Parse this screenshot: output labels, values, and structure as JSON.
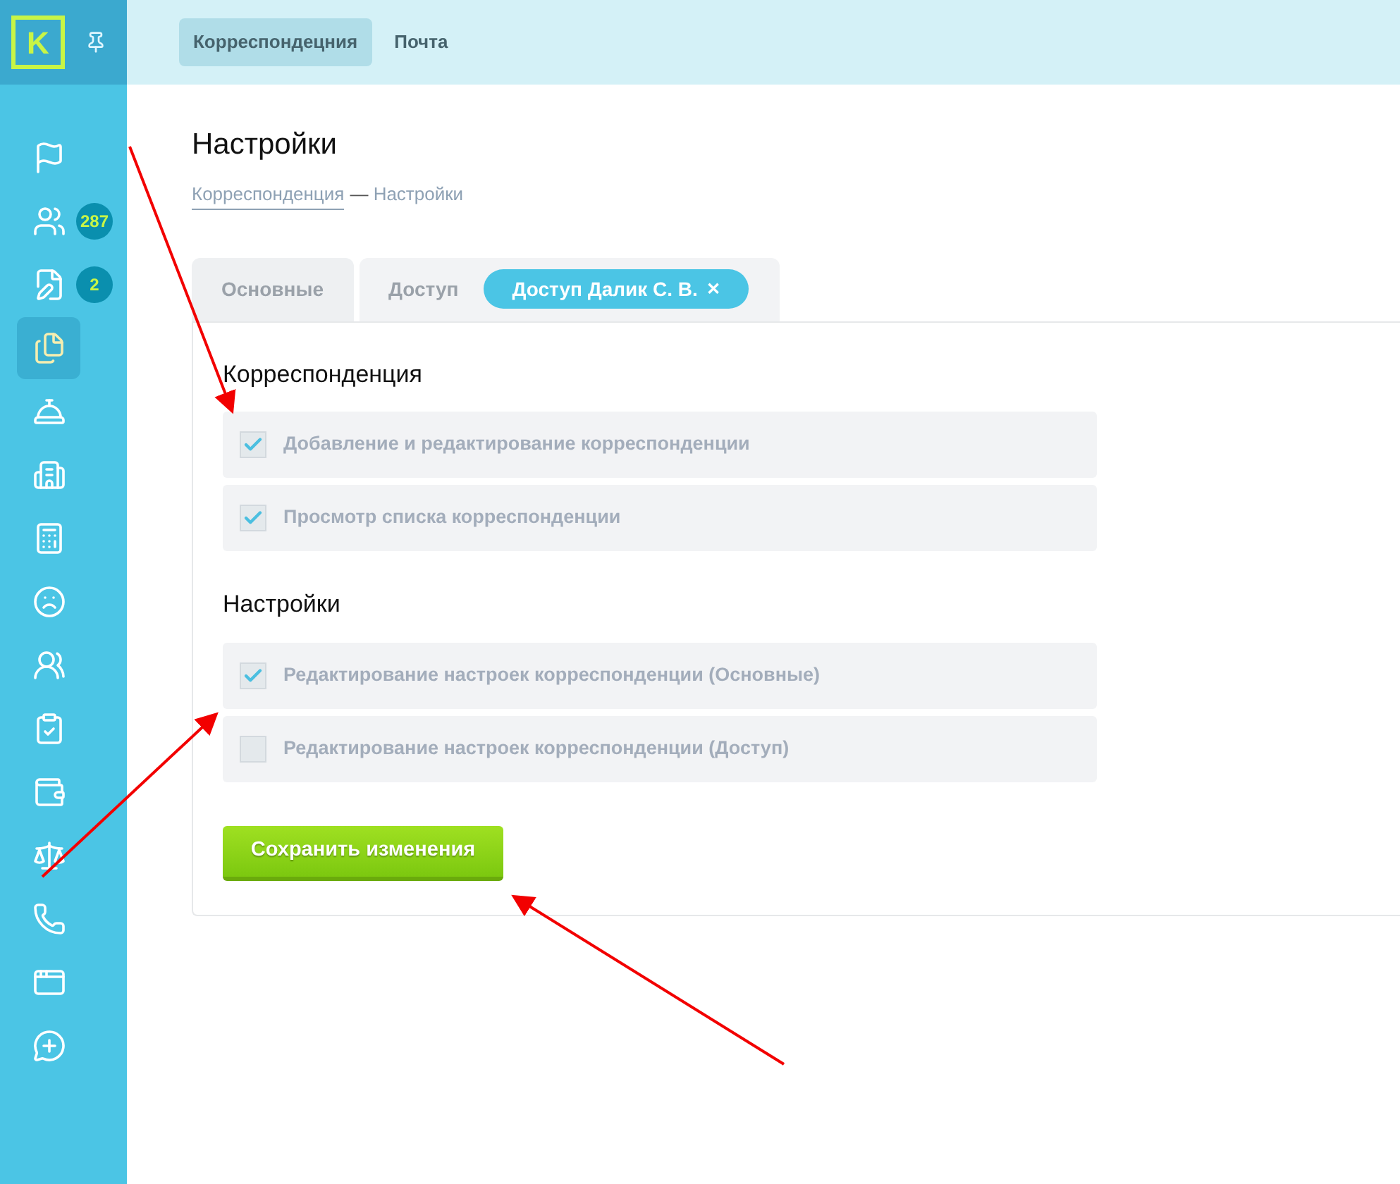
{
  "sidebar": {
    "logo": "K",
    "items": [
      {
        "selected": false
      },
      {
        "selected": false,
        "badge": "287"
      },
      {
        "selected": false,
        "badge": "2"
      },
      {
        "selected": true
      },
      {
        "selected": false
      },
      {
        "selected": false
      },
      {
        "selected": false
      },
      {
        "selected": false
      },
      {
        "selected": false
      },
      {
        "selected": false
      },
      {
        "selected": false
      },
      {
        "selected": false
      },
      {
        "selected": false
      },
      {
        "selected": false
      },
      {
        "selected": false
      }
    ]
  },
  "top_tabs": [
    {
      "label": "Корреспондецния",
      "selected": true
    },
    {
      "label": "Почта",
      "selected": false
    }
  ],
  "title": "Настройки",
  "breadcrumb": {
    "link": "Корреспонденция",
    "separator": "—",
    "current": "Настройки"
  },
  "tabs": [
    {
      "label": "Основные",
      "selected": false
    },
    {
      "label": "Доступ",
      "selected": true,
      "chip": "Доступ Далик С. В.",
      "chip_close": "✕"
    }
  ],
  "sections": [
    {
      "title": "Корреспонденция",
      "items": [
        {
          "label": "Добавление и редактирование корреспонденции",
          "checked": true
        },
        {
          "label": "Просмотр списка корреспонденции",
          "checked": true
        }
      ]
    },
    {
      "title": "Настройки",
      "items": [
        {
          "label": "Редактирование настроек корреспонденции (Основные)",
          "checked": true
        },
        {
          "label": "Редактирование настроек корреспонденции (Доступ)",
          "checked": false
        }
      ]
    }
  ],
  "save_button": "Сохранить изменения"
}
